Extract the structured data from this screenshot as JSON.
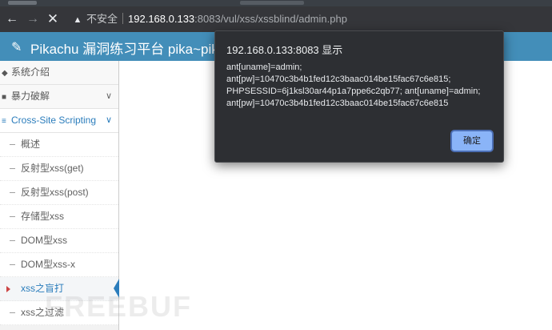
{
  "browser": {
    "back_icon": "←",
    "forward_icon": "→",
    "reload_icon": "✕",
    "insecure_label": "不安全",
    "url_host": "192.168.0.133",
    "url_path": ":8083/vul/xss/xssblind/admin.php"
  },
  "header": {
    "title": "Pikachu 漏洞练习平台 pika~pika~"
  },
  "sidebar": {
    "items": [
      {
        "label": "系统介绍"
      },
      {
        "label": "暴力破解"
      },
      {
        "label": "Cross-Site Scripting"
      }
    ],
    "sub_items": [
      {
        "label": "概述"
      },
      {
        "label": "反射型xss(get)"
      },
      {
        "label": "反射型xss(post)"
      },
      {
        "label": "存储型xss"
      },
      {
        "label": "DOM型xss"
      },
      {
        "label": "DOM型xss-x"
      },
      {
        "label": "xss之盲打"
      },
      {
        "label": "xss之过滤"
      }
    ]
  },
  "dialog": {
    "title": "192.168.0.133:8083 显示",
    "lines": [
      "ant[uname]=admin;",
      "ant[pw]=10470c3b4b1fed12c3baac014be15fac67c6e815;",
      "PHPSESSID=6j1ksl30ar44p1a7ppe6c2qb77; ant[uname]=admin;",
      "ant[pw]=10470c3b4b1fed12c3baac014be15fac67c6e815"
    ],
    "ok_label": "确定"
  },
  "watermark": "FREEBUF",
  "colors": {
    "header_bg": "#438eb9",
    "active_blue": "#2b7dbc",
    "dialog_bg": "#2d2f33",
    "ok_button": "#8ab4f8"
  }
}
